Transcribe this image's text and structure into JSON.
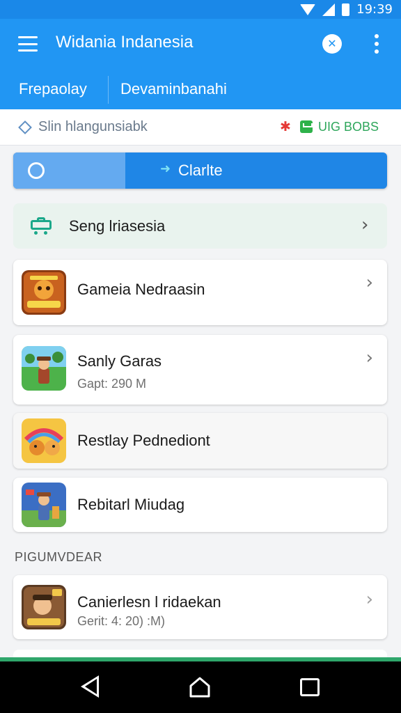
{
  "status_bar": {
    "time": "19:39"
  },
  "app_bar": {
    "title": "Widania Indanesia",
    "action_icon": "x-circle-icon",
    "menu_icon": "more-vert-icon"
  },
  "tabs": [
    {
      "label": "Frepaolay"
    },
    {
      "label": "Devaminbanahi"
    }
  ],
  "subheader": {
    "left_label": "Slin hlangunsiabk",
    "right_label": "UIG BOBS"
  },
  "segment": {
    "active_label": "Clarlte"
  },
  "settings_row": {
    "label": "Seng lriasesia"
  },
  "cards": [
    {
      "title": "Gameia Nedraasin"
    },
    {
      "title": "Sanly Garas",
      "meta": "Gapt: 290 M"
    },
    {
      "title": "Restlay Pednediont"
    },
    {
      "title": "Rebitarl Miudag"
    }
  ],
  "section": {
    "label": "PIGUMVDEAR"
  },
  "section_cards": [
    {
      "title": "Canierlesn l ridaekan",
      "meta": "Gerit: 4: 20) :M)"
    }
  ],
  "colors": {
    "primary": "#2196f3",
    "status_bar": "#1a88e8",
    "accent_green": "#2ea65b",
    "accent_red": "#e53935"
  }
}
